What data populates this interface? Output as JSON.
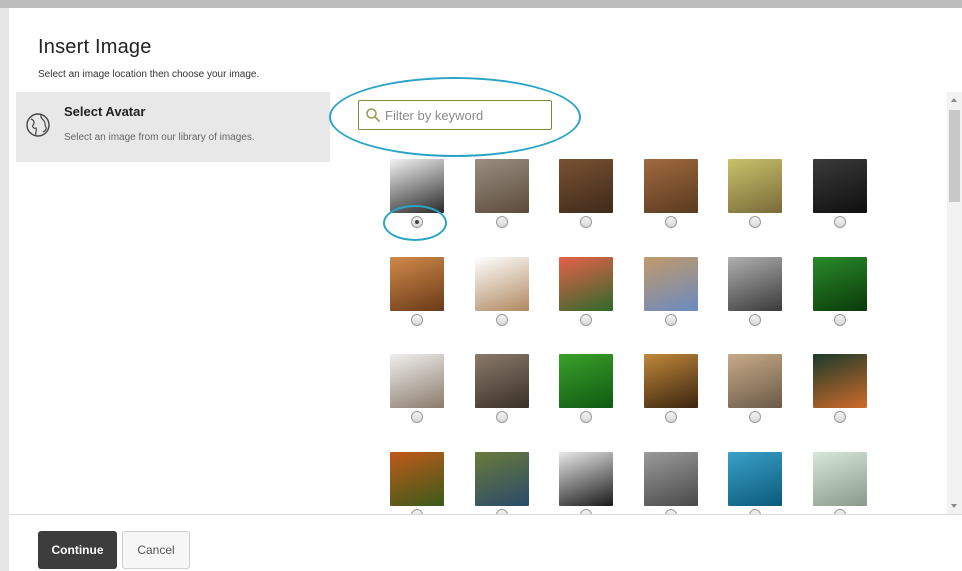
{
  "dialog": {
    "title": "Insert Image",
    "subtitle": "Select an image location then choose your image."
  },
  "sidebar": {
    "items": [
      {
        "label": "Select Avatar",
        "description": "Select an image from our library of images.",
        "icon": "globe-icon"
      }
    ]
  },
  "search": {
    "placeholder": "Filter by keyword",
    "value": "",
    "icon": "search-icon"
  },
  "gallery": {
    "selected_index": 0,
    "images": [
      {
        "name": "eagle",
        "colors": [
          "#f2f2f2",
          "#2a2a2a"
        ]
      },
      {
        "name": "two-eagles",
        "colors": [
          "#9a8f82",
          "#5b4a3a"
        ]
      },
      {
        "name": "brown-bear-1",
        "colors": [
          "#7a5232",
          "#3e2a1a"
        ]
      },
      {
        "name": "brown-bear-2",
        "colors": [
          "#a06a3e",
          "#5a3a20"
        ]
      },
      {
        "name": "dragonfly",
        "colors": [
          "#c8c26a",
          "#7a6a3a"
        ]
      },
      {
        "name": "monkey",
        "colors": [
          "#3a3a3a",
          "#0f0f0f"
        ]
      },
      {
        "name": "squirrel",
        "colors": [
          "#d08a4a",
          "#6a3a18"
        ]
      },
      {
        "name": "camel",
        "colors": [
          "#ffffff",
          "#b08860"
        ]
      },
      {
        "name": "flamingos",
        "colors": [
          "#e8604a",
          "#2f6a2a"
        ]
      },
      {
        "name": "gazelles",
        "colors": [
          "#c29a6a",
          "#6a8ac0"
        ]
      },
      {
        "name": "wolf",
        "colors": [
          "#b0b0b0",
          "#3a3a3a"
        ]
      },
      {
        "name": "frog",
        "colors": [
          "#2a8a2a",
          "#0a3a0a"
        ]
      },
      {
        "name": "hedgehog",
        "colors": [
          "#f0f0f0",
          "#8a7a6a"
        ]
      },
      {
        "name": "owl",
        "colors": [
          "#8a7a6a",
          "#3a3028"
        ]
      },
      {
        "name": "ladybug",
        "colors": [
          "#3aa02a",
          "#0f5a12"
        ]
      },
      {
        "name": "lion",
        "colors": [
          "#c0883a",
          "#3a2410"
        ]
      },
      {
        "name": "meerkats",
        "colors": [
          "#c8aa88",
          "#6a5a48"
        ]
      },
      {
        "name": "butterfly",
        "colors": [
          "#1a3a2a",
          "#d06a2a"
        ]
      },
      {
        "name": "orangutan",
        "colors": [
          "#c05a1a",
          "#3a5a1a"
        ]
      },
      {
        "name": "peacock",
        "colors": [
          "#6a7a3a",
          "#2a4a6a"
        ]
      },
      {
        "name": "penguins",
        "colors": [
          "#e8e8e8",
          "#1a1a1a"
        ]
      },
      {
        "name": "rhino",
        "colors": [
          "#9a9a9a",
          "#4a4a4a"
        ]
      },
      {
        "name": "sea-turtle",
        "colors": [
          "#3aa0c8",
          "#0a5a7a"
        ]
      },
      {
        "name": "seal",
        "colors": [
          "#d8e8d8",
          "#8a9a8a"
        ]
      }
    ]
  },
  "footer": {
    "continue_label": "Continue",
    "cancel_label": "Cancel"
  },
  "colors": {
    "highlight_ring": "#2aa4c6",
    "search_border": "#7c8a3a",
    "primary_button": "#3d3d3d"
  }
}
